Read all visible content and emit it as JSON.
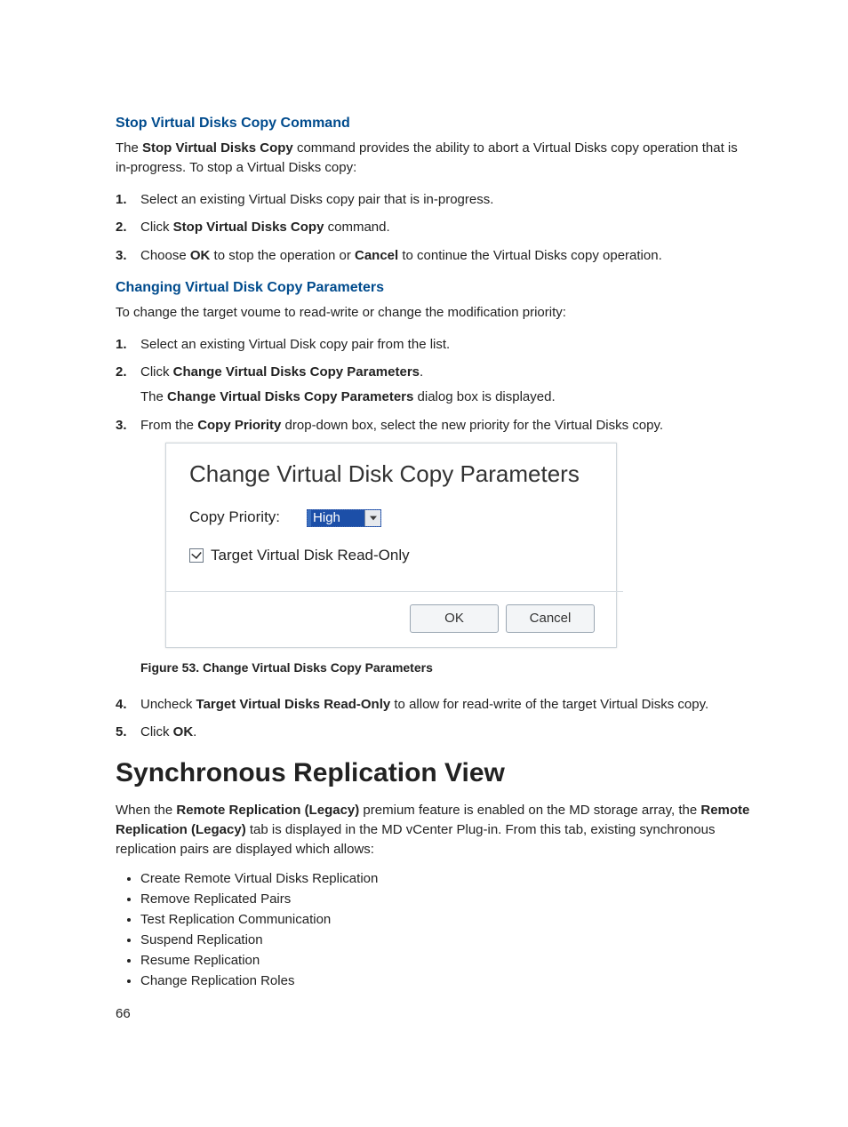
{
  "sections": {
    "stop": {
      "heading": "Stop Virtual Disks Copy Command",
      "intro_pre": "The ",
      "intro_bold": "Stop Virtual Disks Copy",
      "intro_post": " command provides the ability to abort a Virtual Disks copy operation that is in-progress. To stop a Virtual Disks copy:",
      "steps": {
        "s1": "Select an existing Virtual Disks copy pair that is in-progress.",
        "s2_pre": "Click ",
        "s2_b": "Stop Virtual Disks Copy",
        "s2_post": " command.",
        "s3_a": "Choose ",
        "s3_b1": "OK",
        "s3_c": " to stop the operation or ",
        "s3_b2": "Cancel",
        "s3_d": " to continue the Virtual Disks copy operation."
      }
    },
    "change": {
      "heading": "Changing Virtual Disk Copy Parameters",
      "intro": "To change the target voume to read-write or change the modification priority:",
      "steps": {
        "s1": "Select an existing Virtual Disk copy pair from the list.",
        "s2_pre": "Click ",
        "s2_b": "Change Virtual Disks Copy Parameters",
        "s2_post": ".",
        "s2_sub_pre": "The ",
        "s2_sub_b": "Change Virtual Disks Copy Parameters",
        "s2_sub_post": " dialog box is displayed.",
        "s3_pre": "From the ",
        "s3_b": "Copy Priority",
        "s3_post": " drop-down box, select the new priority for the Virtual Disks copy.",
        "figcap": "Figure 53. Change Virtual Disks Copy Parameters",
        "s4_pre": "Uncheck ",
        "s4_b": "Target Virtual Disks Read-Only",
        "s4_post": " to allow for read-write of the target Virtual Disks copy.",
        "s5_pre": "Click ",
        "s5_b": "OK",
        "s5_post": "."
      }
    },
    "dialog": {
      "title": "Change Virtual Disk Copy Parameters",
      "label_priority": "Copy Priority:",
      "dropdown_value": "High",
      "checkbox_label": "Target Virtual Disk Read-Only",
      "ok": "OK",
      "cancel": "Cancel"
    },
    "sync": {
      "heading": "Synchronous Replication View",
      "intro_a": "When the ",
      "intro_b1": "Remote Replication (Legacy)",
      "intro_c": " premium feature is enabled on the MD storage array, the ",
      "intro_b2": "Remote Replication (Legacy)",
      "intro_d": " tab is displayed in the MD vCenter Plug-in. From this tab, existing synchronous replication pairs are displayed which allows:",
      "bullets": {
        "b1": "Create Remote Virtual Disks Replication",
        "b2": "Remove Replicated Pairs",
        "b3": "Test Replication Communication",
        "b4": "Suspend Replication",
        "b5": "Resume Replication",
        "b6": "Change Replication Roles"
      }
    },
    "pgno": "66"
  }
}
